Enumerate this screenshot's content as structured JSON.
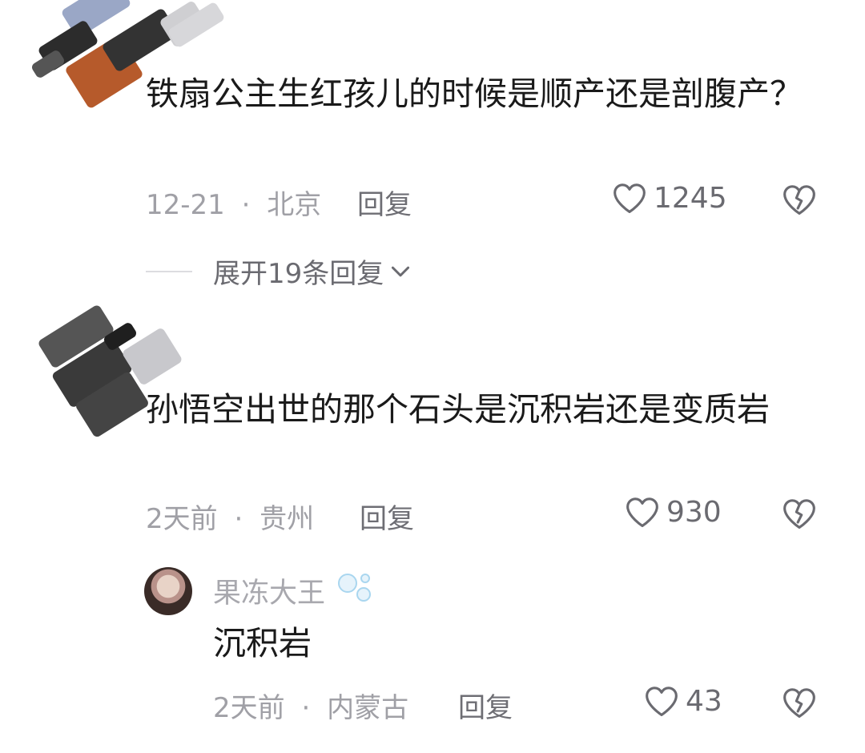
{
  "comments": [
    {
      "text": "铁扇公主生红孩儿的时候是顺产还是剖腹产？",
      "date": "12-21",
      "separator": "·",
      "location": "北京",
      "reply_label": "回复",
      "likes": "1245",
      "expand_label": "展开19条回复"
    },
    {
      "text": "孙悟空出世的那个石头是沉积岩还是变质岩",
      "date": "2天前",
      "separator": "·",
      "location": "贵州",
      "reply_label": "回复",
      "likes": "930",
      "reply": {
        "username": "果冻大王",
        "text": "沉积岩",
        "date": "2天前",
        "separator": "·",
        "location": "内蒙古",
        "reply_label": "回复",
        "likes": "43"
      }
    }
  ],
  "icons": {
    "like": "heart-outline-icon",
    "dislike": "broken-heart-icon",
    "expand": "chevron-down-icon",
    "badge": "bubbles-icon"
  },
  "colors": {
    "text": "#1a1a1a",
    "meta": "#a0a0a6",
    "icon": "#6a6a70"
  }
}
